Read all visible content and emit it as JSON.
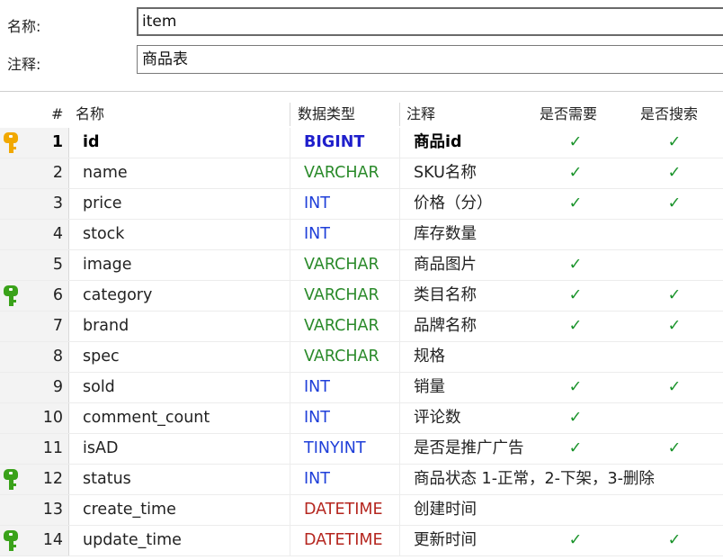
{
  "form": {
    "name_label": "名称:",
    "name_value": "item",
    "comment_label": "注释:",
    "comment_value": "商品表"
  },
  "columns": {
    "num": "#",
    "name": "名称",
    "type": "数据类型",
    "comment": "注释",
    "required": "是否需要",
    "searchable": "是否搜索"
  },
  "colors": {
    "check": "#19932a",
    "primary_key": "#f1a800",
    "index_key": "#3aa21a",
    "bigint_int": "#1f3fd9",
    "varchar": "#2a8a2a",
    "datetime": "#b5261f"
  },
  "check_symbol": "✓",
  "rows": [
    {
      "num": "1",
      "name": "id",
      "type": "BIGINT",
      "comment": "商品id",
      "required": true,
      "searchable": true,
      "key": "primary-key-icon"
    },
    {
      "num": "2",
      "name": "name",
      "type": "VARCHAR",
      "comment": "SKU名称",
      "required": true,
      "searchable": true,
      "key": ""
    },
    {
      "num": "3",
      "name": "price",
      "type": "INT",
      "comment": "价格（分）",
      "required": true,
      "searchable": true,
      "key": ""
    },
    {
      "num": "4",
      "name": "stock",
      "type": "INT",
      "comment": "库存数量",
      "required": false,
      "searchable": false,
      "key": ""
    },
    {
      "num": "5",
      "name": "image",
      "type": "VARCHAR",
      "comment": "商品图片",
      "required": true,
      "searchable": false,
      "key": ""
    },
    {
      "num": "6",
      "name": "category",
      "type": "VARCHAR",
      "comment": "类目名称",
      "required": true,
      "searchable": true,
      "key": "index-key-icon"
    },
    {
      "num": "7",
      "name": "brand",
      "type": "VARCHAR",
      "comment": "品牌名称",
      "required": true,
      "searchable": true,
      "key": ""
    },
    {
      "num": "8",
      "name": "spec",
      "type": "VARCHAR",
      "comment": "规格",
      "required": false,
      "searchable": false,
      "key": ""
    },
    {
      "num": "9",
      "name": "sold",
      "type": "INT",
      "comment": "销量",
      "required": true,
      "searchable": true,
      "key": ""
    },
    {
      "num": "10",
      "name": "comment_count",
      "type": "INT",
      "comment": "评论数",
      "required": true,
      "searchable": false,
      "key": ""
    },
    {
      "num": "11",
      "name": "isAD",
      "type": "TINYINT",
      "comment": "是否是推广广告",
      "required": true,
      "searchable": true,
      "key": ""
    },
    {
      "num": "12",
      "name": "status",
      "type": "INT",
      "comment": "商品状态 1-正常，2-下架，3-删除",
      "required": false,
      "searchable": false,
      "key": "index-key-icon"
    },
    {
      "num": "13",
      "name": "create_time",
      "type": "DATETIME",
      "comment": "创建时间",
      "required": false,
      "searchable": false,
      "key": ""
    },
    {
      "num": "14",
      "name": "update_time",
      "type": "DATETIME",
      "comment": "更新时间",
      "required": true,
      "searchable": true,
      "key": "index-key-icon"
    }
  ]
}
